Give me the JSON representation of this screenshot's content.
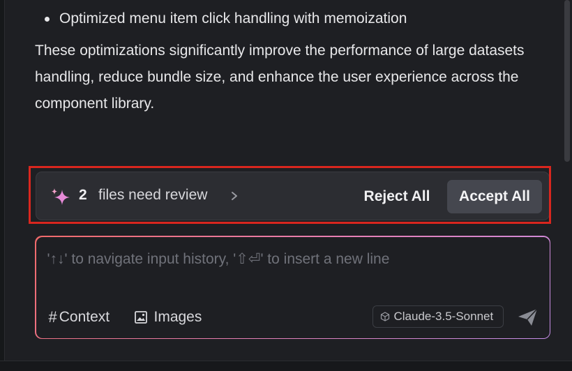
{
  "message": {
    "bullet": "Optimized menu item click handling with memoization",
    "paragraph": "These optimizations significantly improve the performance of large datasets handling, reduce bundle size, and enhance the user experience across the component library."
  },
  "review_bar": {
    "count": "2",
    "text": "files need review",
    "reject_label": "Reject All",
    "accept_label": "Accept All",
    "highlight_color": "#d9261e"
  },
  "composer": {
    "placeholder": "'↑↓' to navigate input history, '⇧⏎' to insert a new line",
    "value": "",
    "context_label": "Context",
    "images_label": "Images",
    "model_label": "Claude-3.5-Sonnet"
  },
  "icons": [
    "sparkle-icon",
    "chevron-right-icon",
    "hash-icon",
    "image-icon",
    "cube-icon",
    "send-icon"
  ],
  "colors": {
    "background": "#1e1f23",
    "review_bar": "#2c2d32",
    "accept_button": "#45474f",
    "input_border_start": "#f06a6a",
    "input_border_end": "#c58ee8"
  }
}
